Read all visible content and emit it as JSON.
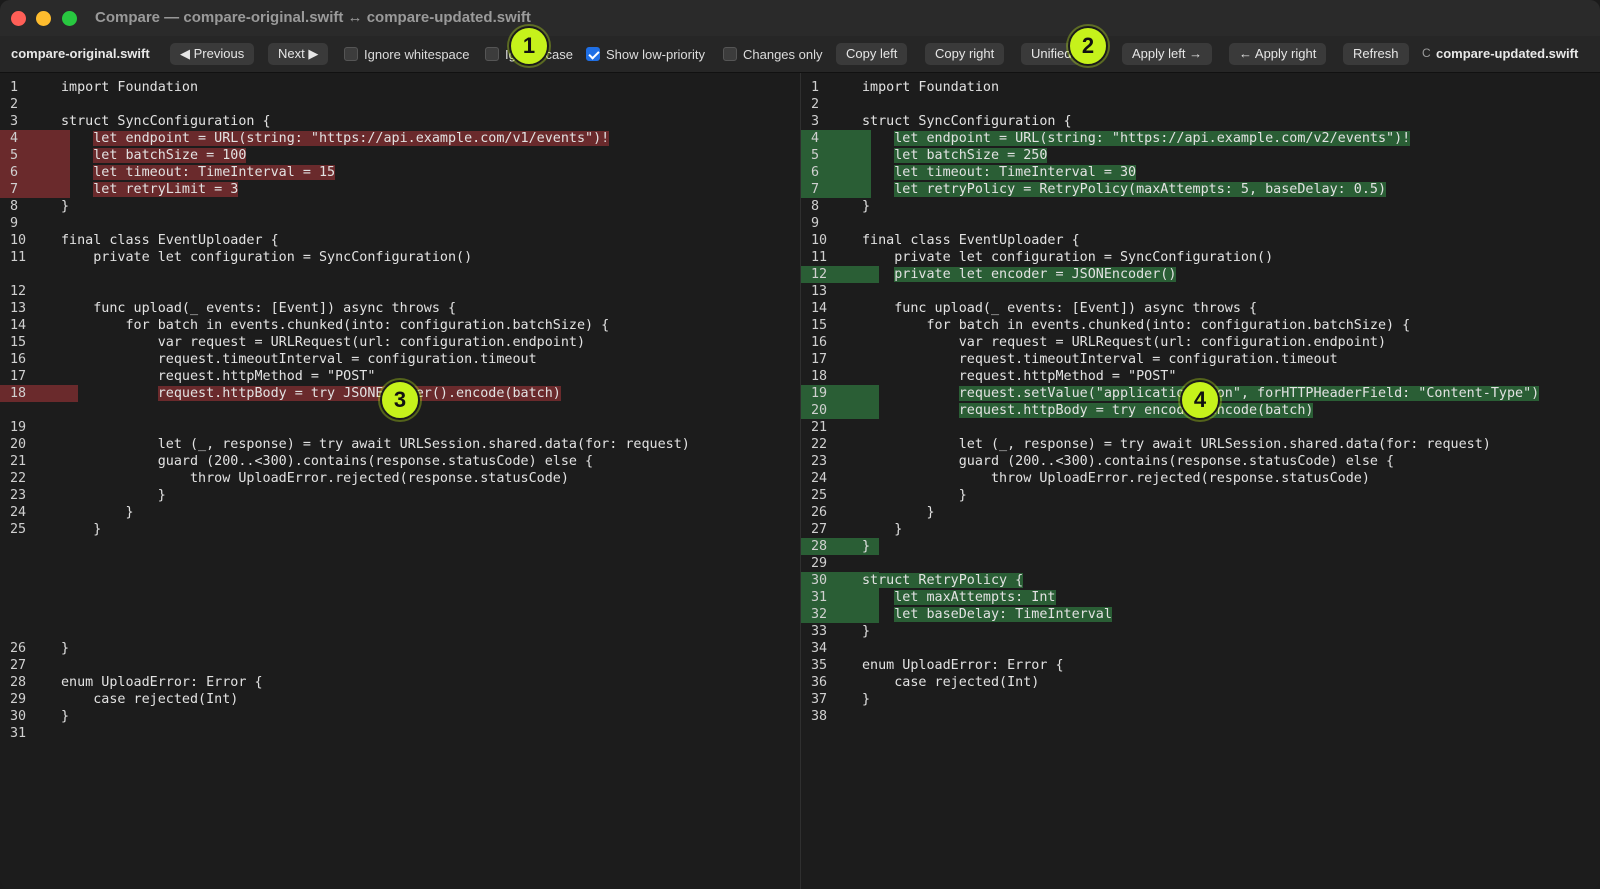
{
  "window": {
    "title": "Compare — compare-original.swift ↔ compare-updated.swift"
  },
  "toolbar": {
    "left_file": "compare-original.swift",
    "right_file": "compare-updated.swift",
    "previous": "◀ Previous",
    "next": "Next ▶",
    "ignore_whitespace": "Ignore whitespace",
    "ignore_case": "Ignore case",
    "show_low_priority": "Show low-priority",
    "changes_only": "Changes only",
    "copy_left": "Copy left",
    "copy_right": "Copy right",
    "unified": "Unified",
    "apply_left": "Apply left →",
    "apply_right": "← Apply right",
    "refresh": "Refresh",
    "overflow": "C"
  },
  "badges": [
    "1",
    "2",
    "3",
    "4"
  ],
  "left": {
    "lines": [
      {
        "n": "1",
        "t": "import Foundation",
        "k": ""
      },
      {
        "n": "2",
        "t": "",
        "k": ""
      },
      {
        "n": "3",
        "t": "struct SyncConfiguration {",
        "k": ""
      },
      {
        "n": "4",
        "t": "    let endpoint = URL(string: \"https://api.example.com/v1/events\")!",
        "k": "del"
      },
      {
        "n": "5",
        "t": "    let batchSize = 100",
        "k": "del"
      },
      {
        "n": "6",
        "t": "    let timeout: TimeInterval = 15",
        "k": "del"
      },
      {
        "n": "7",
        "t": "    let retryLimit = 3",
        "k": "del"
      },
      {
        "n": "8",
        "t": "}",
        "k": ""
      },
      {
        "n": "9",
        "t": "",
        "k": ""
      },
      {
        "n": "10",
        "t": "final class EventUploader {",
        "k": ""
      },
      {
        "n": "11",
        "t": "    private let configuration = SyncConfiguration()",
        "k": ""
      },
      {
        "n": "",
        "t": "",
        "k": "gap"
      },
      {
        "n": "12",
        "t": "",
        "k": ""
      },
      {
        "n": "13",
        "t": "    func upload(_ events: [Event]) async throws {",
        "k": ""
      },
      {
        "n": "14",
        "t": "        for batch in events.chunked(into: configuration.batchSize) {",
        "k": ""
      },
      {
        "n": "15",
        "t": "            var request = URLRequest(url: configuration.endpoint)",
        "k": ""
      },
      {
        "n": "16",
        "t": "            request.timeoutInterval = configuration.timeout",
        "k": ""
      },
      {
        "n": "17",
        "t": "            request.httpMethod = \"POST\"",
        "k": ""
      },
      {
        "n": "18",
        "t": "            request.httpBody = try JSONEncoder().encode(batch)",
        "k": "del"
      },
      {
        "n": "",
        "t": "",
        "k": "gap"
      },
      {
        "n": "19",
        "t": "",
        "k": ""
      },
      {
        "n": "20",
        "t": "            let (_, response) = try await URLSession.shared.data(for: request)",
        "k": ""
      },
      {
        "n": "21",
        "t": "            guard (200..<300).contains(response.statusCode) else {",
        "k": ""
      },
      {
        "n": "22",
        "t": "                throw UploadError.rejected(response.statusCode)",
        "k": ""
      },
      {
        "n": "23",
        "t": "            }",
        "k": ""
      },
      {
        "n": "24",
        "t": "        }",
        "k": ""
      },
      {
        "n": "25",
        "t": "    }",
        "k": ""
      },
      {
        "n": "",
        "t": "",
        "k": "gap"
      },
      {
        "n": "",
        "t": "",
        "k": "gap"
      },
      {
        "n": "",
        "t": "",
        "k": "gap"
      },
      {
        "n": "",
        "t": "",
        "k": "gap"
      },
      {
        "n": "",
        "t": "",
        "k": "gap"
      },
      {
        "n": "",
        "t": "",
        "k": "gap"
      },
      {
        "n": "26",
        "t": "}",
        "k": ""
      },
      {
        "n": "27",
        "t": "",
        "k": ""
      },
      {
        "n": "28",
        "t": "enum UploadError: Error {",
        "k": ""
      },
      {
        "n": "29",
        "t": "    case rejected(Int)",
        "k": ""
      },
      {
        "n": "30",
        "t": "}",
        "k": ""
      },
      {
        "n": "31",
        "t": "",
        "k": ""
      }
    ]
  },
  "right": {
    "lines": [
      {
        "n": "1",
        "t": "import Foundation",
        "k": ""
      },
      {
        "n": "2",
        "t": "",
        "k": ""
      },
      {
        "n": "3",
        "t": "struct SyncConfiguration {",
        "k": ""
      },
      {
        "n": "4",
        "t": "    let endpoint = URL(string: \"https://api.example.com/v2/events\")!",
        "k": "add"
      },
      {
        "n": "5",
        "t": "    let batchSize = 250",
        "k": "add"
      },
      {
        "n": "6",
        "t": "    let timeout: TimeInterval = 30",
        "k": "add"
      },
      {
        "n": "7",
        "t": "    let retryPolicy = RetryPolicy(maxAttempts: 5, baseDelay: 0.5)",
        "k": "add"
      },
      {
        "n": "8",
        "t": "}",
        "k": ""
      },
      {
        "n": "9",
        "t": "",
        "k": ""
      },
      {
        "n": "10",
        "t": "final class EventUploader {",
        "k": ""
      },
      {
        "n": "11",
        "t": "    private let configuration = SyncConfiguration()",
        "k": ""
      },
      {
        "n": "12",
        "t": "    private let encoder = JSONEncoder()",
        "k": "add"
      },
      {
        "n": "13",
        "t": "",
        "k": ""
      },
      {
        "n": "14",
        "t": "    func upload(_ events: [Event]) async throws {",
        "k": ""
      },
      {
        "n": "15",
        "t": "        for batch in events.chunked(into: configuration.batchSize) {",
        "k": ""
      },
      {
        "n": "16",
        "t": "            var request = URLRequest(url: configuration.endpoint)",
        "k": ""
      },
      {
        "n": "17",
        "t": "            request.timeoutInterval = configuration.timeout",
        "k": ""
      },
      {
        "n": "18",
        "t": "            request.httpMethod = \"POST\"",
        "k": ""
      },
      {
        "n": "19",
        "t": "            request.setValue(\"application/json\", forHTTPHeaderField: \"Content-Type\")",
        "k": "add"
      },
      {
        "n": "20",
        "t": "            request.httpBody = try encoder.encode(batch)",
        "k": "add"
      },
      {
        "n": "21",
        "t": "",
        "k": ""
      },
      {
        "n": "22",
        "t": "            let (_, response) = try await URLSession.shared.data(for: request)",
        "k": ""
      },
      {
        "n": "23",
        "t": "            guard (200..<300).contains(response.statusCode) else {",
        "k": ""
      },
      {
        "n": "24",
        "t": "                throw UploadError.rejected(response.statusCode)",
        "k": ""
      },
      {
        "n": "25",
        "t": "            }",
        "k": ""
      },
      {
        "n": "26",
        "t": "        }",
        "k": ""
      },
      {
        "n": "27",
        "t": "    }",
        "k": ""
      },
      {
        "n": "28",
        "t": "}",
        "k": "add"
      },
      {
        "n": "29",
        "t": "",
        "k": ""
      },
      {
        "n": "30",
        "t": "struct RetryPolicy {",
        "k": "add"
      },
      {
        "n": "31",
        "t": "    let maxAttempts: Int",
        "k": "add"
      },
      {
        "n": "32",
        "t": "    let baseDelay: TimeInterval",
        "k": "add"
      },
      {
        "n": "33",
        "t": "}",
        "k": ""
      },
      {
        "n": "34",
        "t": "",
        "k": ""
      },
      {
        "n": "35",
        "t": "enum UploadError: Error {",
        "k": ""
      },
      {
        "n": "36",
        "t": "    case rejected(Int)",
        "k": ""
      },
      {
        "n": "37",
        "t": "}",
        "k": ""
      },
      {
        "n": "38",
        "t": "",
        "k": ""
      }
    ]
  },
  "colors": {
    "deleted": "#6a2a2c",
    "added": "#2a5e35",
    "badge": "#c6f21b",
    "accent": "#1f6fe5"
  }
}
